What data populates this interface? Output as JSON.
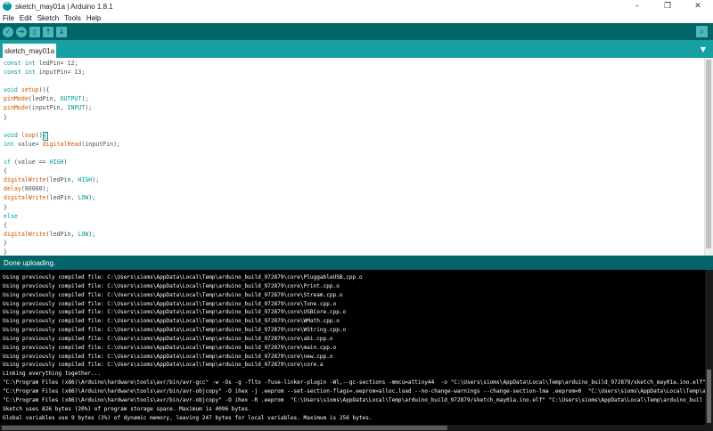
{
  "window": {
    "title": "sketch_may01a | Arduino 1.8.1",
    "minimize": "–",
    "maximize": "❐",
    "close": "✕"
  },
  "menu": [
    "File",
    "Edit",
    "Sketch",
    "Tools",
    "Help"
  ],
  "toolbar": {
    "verify": "✓",
    "upload": "➔",
    "new": "▯",
    "open": "↑",
    "save": "↓",
    "serial_monitor": "⌕"
  },
  "tabs": [
    {
      "label": "sketch_may01a"
    }
  ],
  "tab_menu": "▼",
  "code": [
    [
      {
        "t": "const",
        "c": "kw"
      },
      {
        "t": " "
      },
      {
        "t": "int",
        "c": "kw"
      },
      {
        "t": " ledPin= 12;"
      }
    ],
    [
      {
        "t": "const",
        "c": "kw"
      },
      {
        "t": " "
      },
      {
        "t": "int",
        "c": "kw"
      },
      {
        "t": " inputPin= 13;"
      }
    ],
    [],
    [
      {
        "t": "void",
        "c": "kw"
      },
      {
        "t": " "
      },
      {
        "t": "setup",
        "c": "fn"
      },
      {
        "t": "(){"
      }
    ],
    [
      {
        "t": "pinMode",
        "c": "fn"
      },
      {
        "t": "(ledPin, "
      },
      {
        "t": "OUTPUT",
        "c": "const"
      },
      {
        "t": ");"
      }
    ],
    [
      {
        "t": "pinMode",
        "c": "fn"
      },
      {
        "t": "(inputPin, "
      },
      {
        "t": "INPUT",
        "c": "const"
      },
      {
        "t": ");"
      }
    ],
    [
      {
        "t": "}"
      }
    ],
    [],
    [
      {
        "t": "void",
        "c": "kw"
      },
      {
        "t": " "
      },
      {
        "t": "loop",
        "c": "fn"
      },
      {
        "t": "()"
      },
      {
        "t": "{",
        "c": "cursor"
      }
    ],
    [
      {
        "t": "int",
        "c": "kw"
      },
      {
        "t": " value= "
      },
      {
        "t": "digitalRead",
        "c": "fn"
      },
      {
        "t": "(inputPin);"
      }
    ],
    [],
    [
      {
        "t": "if",
        "c": "kw"
      },
      {
        "t": " (value == "
      },
      {
        "t": "HIGH",
        "c": "const"
      },
      {
        "t": ")"
      }
    ],
    [
      {
        "t": "{"
      }
    ],
    [
      {
        "t": "digitalWrite",
        "c": "fn"
      },
      {
        "t": "(ledPin, "
      },
      {
        "t": "HIGH",
        "c": "const"
      },
      {
        "t": ");"
      }
    ],
    [
      {
        "t": "delay",
        "c": "fn"
      },
      {
        "t": "(60000);"
      }
    ],
    [
      {
        "t": "digitalWrite",
        "c": "fn"
      },
      {
        "t": "(ledPin, "
      },
      {
        "t": "LOW",
        "c": "const"
      },
      {
        "t": ");"
      }
    ],
    [
      {
        "t": "}"
      }
    ],
    [
      {
        "t": "else",
        "c": "kw"
      }
    ],
    [
      {
        "t": "{"
      }
    ],
    [
      {
        "t": "digitalWrite",
        "c": "fn"
      },
      {
        "t": "(ledPin, "
      },
      {
        "t": "LOW",
        "c": "const"
      },
      {
        "t": ");"
      }
    ],
    [
      {
        "t": "}"
      }
    ],
    [
      {
        "t": "}"
      }
    ]
  ],
  "status": "Done uploading.",
  "console": [
    "Using previously compiled file: C:\\Users\\sioms\\AppData\\Local\\Temp\\arduino_build_972879\\core\\PluggableUSB.cpp.o",
    "Using previously compiled file: C:\\Users\\sioms\\AppData\\Local\\Temp\\arduino_build_972879\\core\\Print.cpp.o",
    "Using previously compiled file: C:\\Users\\sioms\\AppData\\Local\\Temp\\arduino_build_972879\\core\\Stream.cpp.o",
    "Using previously compiled file: C:\\Users\\sioms\\AppData\\Local\\Temp\\arduino_build_972879\\core\\Tone.cpp.o",
    "Using previously compiled file: C:\\Users\\sioms\\AppData\\Local\\Temp\\arduino_build_972879\\core\\USBCore.cpp.o",
    "Using previously compiled file: C:\\Users\\sioms\\AppData\\Local\\Temp\\arduino_build_972879\\core\\WMath.cpp.o",
    "Using previously compiled file: C:\\Users\\sioms\\AppData\\Local\\Temp\\arduino_build_972879\\core\\WString.cpp.o",
    "Using previously compiled file: C:\\Users\\sioms\\AppData\\Local\\Temp\\arduino_build_972879\\core\\abi.cpp.o",
    "Using previously compiled file: C:\\Users\\sioms\\AppData\\Local\\Temp\\arduino_build_972879\\core\\main.cpp.o",
    "Using previously compiled file: C:\\Users\\sioms\\AppData\\Local\\Temp\\arduino_build_972879\\core\\new.cpp.o",
    "Using previously compiled file: C:\\Users\\sioms\\AppData\\Local\\Temp\\arduino_build_972879\\core\\core.a",
    "Linking everything together...",
    "\"C:\\Program Files (x86)\\Arduino\\hardware\\tools\\avr/bin/avr-gcc\" -w -Os -g -flto -fuse-linker-plugin -Wl,--gc-sections -mmcu=attiny44  -o \"C:\\Users\\sioms\\AppData\\Local\\Temp\\arduino_build_972879/sketch_may01a.ino.elf\" \"C:\\Users",
    "\"C:\\Program Files (x86)\\Arduino\\hardware\\tools\\avr/bin/avr-objcopy\" -O ihex -j .eeprom --set-section-flags=.eeprom=alloc,load --no-change-warnings --change-section-lma .eeprom=0  \"C:\\Users\\sioms\\AppData\\Local\\Temp\\arduino_buil",
    "\"C:\\Program Files (x86)\\Arduino\\hardware\\tools\\avr/bin/avr-objcopy\" -O ihex -R .eeprom  \"C:\\Users\\sioms\\AppData\\Local\\Temp\\arduino_build_972879/sketch_may01a.ino.elf\" \"C:\\Users\\sioms\\AppData\\Local\\Temp\\arduino_buil",
    "Sketch uses 826 bytes (20%) of program storage space. Maximum is 4096 bytes.",
    "Global variables use 9 bytes (3%) of dynamic memory, leaving 247 bytes for local variables. Maximum is 256 bytes."
  ]
}
